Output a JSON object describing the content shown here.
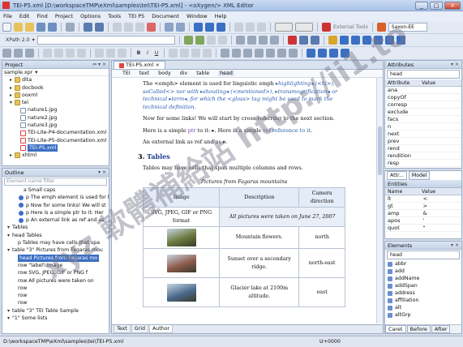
{
  "window": {
    "title": "TEI-P5.xml [D:\\workspaceTMP\\eXml\\samples\\tei\\TEI-P5.xml] - <oXygen/> XML Editor",
    "min": "_",
    "max": "□",
    "close": "×"
  },
  "menu": [
    "File",
    "Edit",
    "Find",
    "Project",
    "Options",
    "Tools",
    "TEI P5",
    "Document",
    "Window",
    "Help"
  ],
  "toolbar": {
    "external_tools": "External Tools",
    "saxon": "Saxon-EE",
    "xpath_label": "XPath 2.0",
    "bold": "B",
    "italic": "I",
    "underline": "U"
  },
  "project": {
    "title": "Project",
    "root": "sample.xpr",
    "items": [
      {
        "type": "folder",
        "label": "dita",
        "level": 1
      },
      {
        "type": "folder",
        "label": "docbook",
        "level": 1
      },
      {
        "type": "folder",
        "label": "ooxml",
        "level": 1
      },
      {
        "type": "folder",
        "label": "tei",
        "level": 1
      },
      {
        "type": "file",
        "label": "nature1.jpg",
        "level": 2
      },
      {
        "type": "file",
        "label": "nature2.jpg",
        "level": 2
      },
      {
        "type": "file",
        "label": "nature3.jpg",
        "level": 2
      },
      {
        "type": "xfile",
        "label": "TEI-Lite-P4-documentation.xml",
        "level": 2
      },
      {
        "type": "xfile",
        "label": "TEI-Lite-P5-documentation.xml",
        "level": 2
      },
      {
        "type": "xfile",
        "label": "TEI-P5.xml",
        "level": 2
      },
      {
        "type": "folder",
        "label": "xhtml",
        "level": 1
      }
    ]
  },
  "outline": {
    "title": "Outline",
    "filter_placeholder": "Element name filter",
    "rows": [
      {
        "text": "a  Small caps",
        "dot": false,
        "indent": 2
      },
      {
        "text": "p  The emph element is used for l",
        "dot": true,
        "indent": 2
      },
      {
        "text": "p  Now for some links! We will st",
        "dot": true,
        "indent": 2
      },
      {
        "text": "p  Here is a simple ptr to it:  Her",
        "dot": true,
        "indent": 2
      },
      {
        "text": "p  An external link as ref and as",
        "dot": true,
        "indent": 2
      },
      {
        "text": "Tables",
        "dot": false,
        "indent": 0
      },
      {
        "text": "head  Tables",
        "dot": false,
        "indent": 0
      },
      {
        "text": "p  Tables may have cells that spa",
        "dot": false,
        "indent": 1
      },
      {
        "text": "table  \"3\" Pictures from Fagaras mou",
        "dot": false,
        "indent": 0
      },
      {
        "text": "head  Pictures from Fagaras mo",
        "dot": false,
        "indent": 1,
        "selected": true
      },
      {
        "text": "row  \"label\" Image",
        "dot": false,
        "indent": 1
      },
      {
        "text": "row  SVG, JPEG, GIF or PNG f",
        "dot": false,
        "indent": 1
      },
      {
        "text": "row  All pictures were taken on",
        "dot": false,
        "indent": 1
      },
      {
        "text": "row",
        "dot": false,
        "indent": 1
      },
      {
        "text": "row",
        "dot": false,
        "indent": 1
      },
      {
        "text": "row",
        "dot": false,
        "indent": 1
      },
      {
        "text": "table  \"3\" TEI Table Sample",
        "dot": false,
        "indent": 0
      },
      {
        "text": "\"1\"  Some lists",
        "dot": false,
        "indent": 0
      }
    ]
  },
  "editor": {
    "tab": "TEI-P5.xml",
    "breadcrumbs": [
      "TEI",
      "text",
      "body",
      "div",
      "table",
      "head"
    ],
    "para1": "The <emph> element is used for linguistic emph",
    "para2": "Now for some links! We will start by cross-referring to the next section.",
    "para3": "Here is a simple ",
    "para4": "An external link as ref and as",
    "section_num": "3.",
    "section_title": "Tables",
    "tables_intro": "Tables may have cells that span multiple columns and rows.",
    "table_caption": "Pictures from Fagaras mountains",
    "col_headers": [
      "Image",
      "Description",
      "Camera direction"
    ],
    "row_formats": "SVG, JPEG, GIF or PNG format",
    "row_alltaken": "All pictures were taken on June 27, 2007",
    "rows": [
      {
        "desc": "Mountain flowers.",
        "dir": "north",
        "img": "#6b7a3c"
      },
      {
        "desc": "Sunset over a secondary ridge.",
        "dir": "north-east",
        "img": "#8c5a4a"
      },
      {
        "desc": "Glacier lake at 2100m altitude.",
        "dir": "east",
        "img": "#4a6a8c"
      }
    ],
    "bottom_tabs": [
      "Text",
      "Grid",
      "Author"
    ],
    "active_bottom_tab": "Author"
  },
  "attributes": {
    "title": "Attributes",
    "element": "head",
    "header": [
      "Attribute",
      "Value"
    ],
    "items": [
      "ana",
      "copyOf",
      "corresp",
      "exclude",
      "facs",
      "n",
      "next",
      "prev",
      "rend",
      "rendition",
      "resp"
    ]
  },
  "entities": {
    "tabs": [
      "Attr...",
      "Model"
    ],
    "title": "Entities",
    "header": [
      "Name",
      "Value"
    ],
    "items": [
      {
        "name": "lt",
        "value": "<"
      },
      {
        "name": "gt",
        "value": ">"
      },
      {
        "name": "amp",
        "value": "&"
      },
      {
        "name": "apos",
        "value": "'"
      },
      {
        "name": "quot",
        "value": "\""
      }
    ]
  },
  "elements": {
    "title": "Elements",
    "context": "head",
    "items": [
      "abbr",
      "add",
      "addName",
      "addSpan",
      "address",
      "affiliation",
      "alt",
      "altGrp"
    ],
    "bottom_tabs": [
      "Caret",
      "Before",
      "After"
    ]
  },
  "status": {
    "path": "D:\\workspaceTMP\\eXml\\samples\\tei\\TEI-P5.xml",
    "char": "U+0000"
  },
  "watermark": "xyz 軟體補給站 http://ii1.to",
  "colors": {
    "accent": "#2a5db0",
    "selection": "#3b6fc4",
    "watermark": "#78788c"
  }
}
